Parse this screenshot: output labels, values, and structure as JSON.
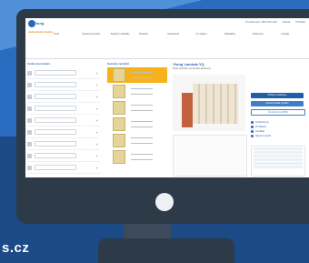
{
  "site": {
    "logo_text": "Ytong",
    "brand_sub": "Jednodušší stavba",
    "domain": "s.cz",
    "top_links": [
      "Poradenství: 800 100 200",
      "Hledat",
      "Přihlásit"
    ]
  },
  "nav": {
    "items": [
      "Úvod",
      "Systémová řešení",
      "Stavební materiály",
      "Produkty",
      "Doporučení",
      "Ke stažení",
      "Kalkulačky",
      "Reference",
      "Kontakt"
    ]
  },
  "filters": {
    "title": "Zvolte konstrukci",
    "count": 9
  },
  "products": {
    "title": "Seznam výrobků",
    "count": 6,
    "selected_index": 0
  },
  "detail": {
    "title": "Ytong Lambda YQ",
    "description": "Popis produktu a technické parametry",
    "buttons": {
      "main": "Přidat do kalkulace",
      "secondary": "Zobrazit detail výrobku",
      "ghost": "Technický list (PDF)"
    },
    "links": [
      "Technický list",
      "Prohlášení",
      "Certifikát",
      "Návod k použití"
    ]
  }
}
